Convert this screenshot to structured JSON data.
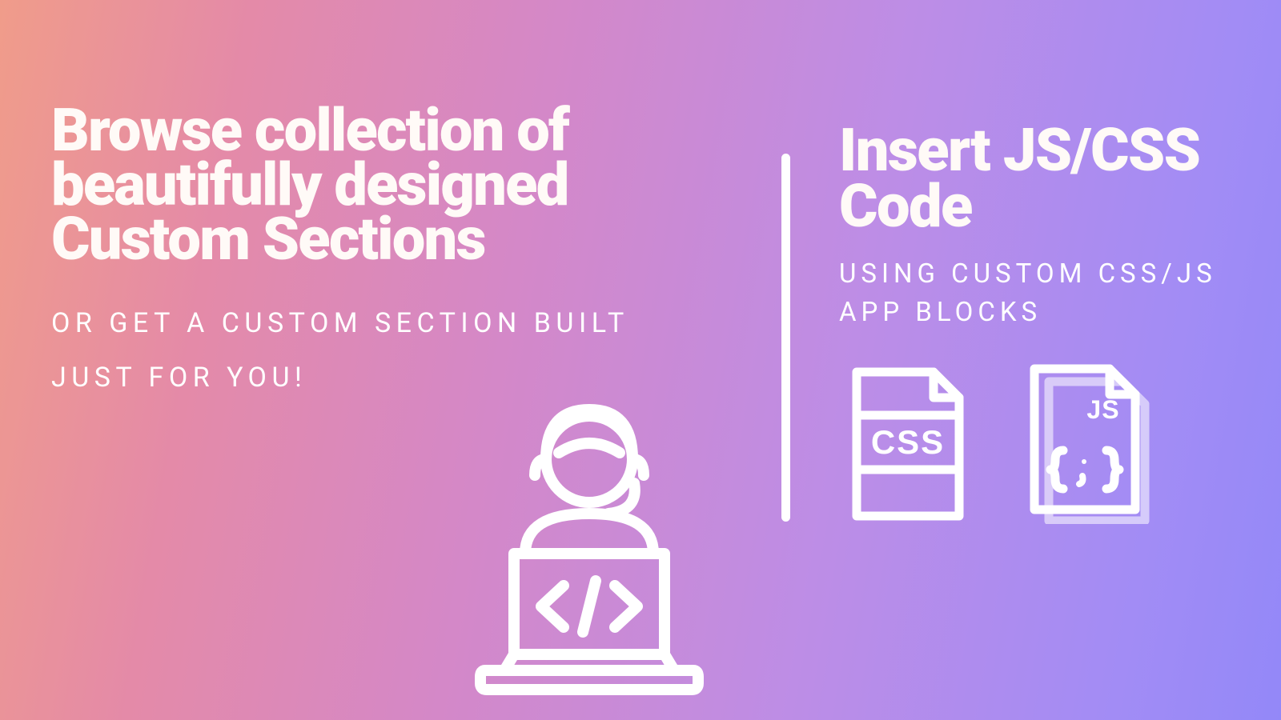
{
  "left": {
    "heading": "Browse collection of beautifully designed Custom Sections",
    "subheading": "OR GET A CUSTOM SECTION BUILT JUST FOR YOU!"
  },
  "right": {
    "heading": "Insert JS/CSS Code",
    "subheading": "USING CUSTOM CSS/JS APP BLOCKS"
  },
  "icons": {
    "developer": "developer-laptop-icon",
    "css_file": "css-file-icon",
    "js_file": "js-file-icon",
    "css_label": "CSS",
    "js_label": "JS"
  },
  "colors": {
    "text": "#ffffff",
    "gradient_start": "#f09c8a",
    "gradient_end": "#9388f8"
  }
}
